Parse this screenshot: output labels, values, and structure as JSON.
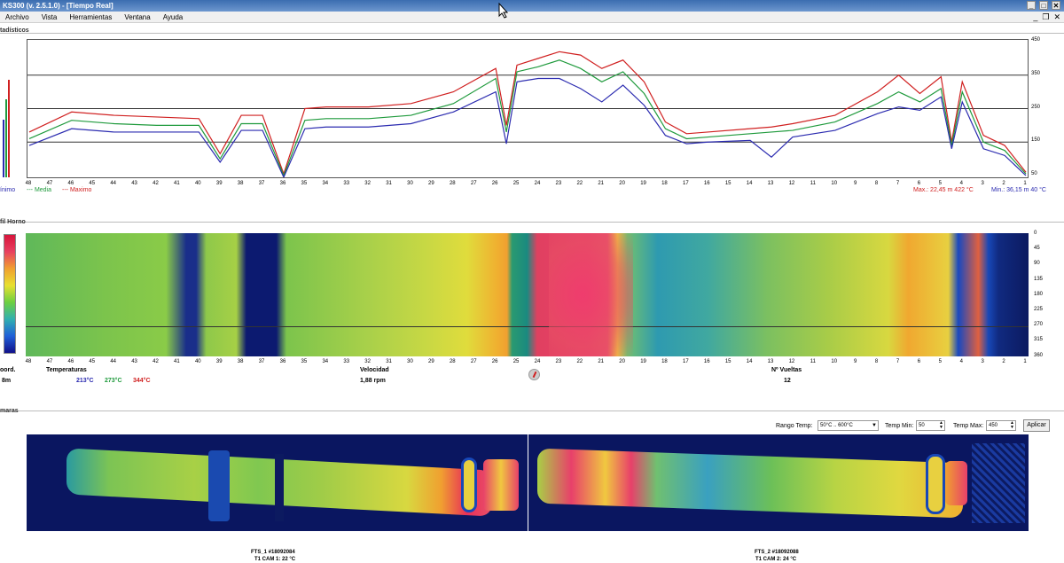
{
  "window": {
    "title": "KS300 (v. 2.5.1.0) - [Tiempo Real]",
    "controls": [
      "_",
      "□",
      "✕"
    ]
  },
  "menu": {
    "items": [
      "Archivo",
      "Vista",
      "Herramientas",
      "Ventana",
      "Ayuda"
    ],
    "mdi_controls": [
      "_",
      "❐",
      "✕"
    ]
  },
  "stats": {
    "title": "tadísticos",
    "y_ticks": [
      "450",
      "350",
      "250",
      "150",
      "50"
    ],
    "x_ticks": [
      "48",
      "47",
      "46",
      "45",
      "44",
      "43",
      "42",
      "41",
      "40",
      "39",
      "38",
      "37",
      "36",
      "35",
      "34",
      "33",
      "32",
      "31",
      "30",
      "29",
      "28",
      "27",
      "26",
      "25",
      "24",
      "23",
      "22",
      "21",
      "20",
      "19",
      "18",
      "17",
      "16",
      "15",
      "14",
      "13",
      "12",
      "11",
      "10",
      "9",
      "8",
      "7",
      "6",
      "5",
      "4",
      "3",
      "2",
      "1"
    ],
    "legend_min": "ínimo",
    "legend_media": "--- Media",
    "legend_max": "--- Maximo",
    "max_readout": "Max.: 22,45 m 422 °C",
    "min_readout": "Min.: 36,15 m 40 °C",
    "colors": {
      "min": "#2b2bb0",
      "media": "#1f9a3c",
      "max": "#d02020"
    }
  },
  "chart_data": {
    "type": "line",
    "x": [
      48,
      46,
      44,
      42,
      40,
      39,
      38,
      37,
      36,
      35,
      34,
      32,
      30,
      28,
      26,
      25.5,
      25,
      24,
      23,
      22,
      21,
      20,
      19,
      18,
      17,
      16,
      14,
      13,
      12,
      10,
      8,
      7,
      6,
      5,
      4.5,
      4,
      3,
      2,
      1
    ],
    "series": [
      {
        "name": "Maximo",
        "values": [
          180,
          240,
          230,
          225,
          220,
          115,
          230,
          230,
          55,
          250,
          255,
          255,
          265,
          300,
          370,
          200,
          380,
          400,
          420,
          410,
          370,
          395,
          330,
          210,
          175,
          180,
          190,
          195,
          205,
          230,
          300,
          350,
          295,
          345,
          150,
          330,
          170,
          140,
          60
        ]
      },
      {
        "name": "Media",
        "values": [
          160,
          215,
          205,
          200,
          200,
          100,
          205,
          205,
          50,
          215,
          220,
          220,
          230,
          265,
          340,
          180,
          360,
          375,
          395,
          370,
          330,
          360,
          295,
          190,
          160,
          165,
          175,
          180,
          185,
          210,
          265,
          300,
          270,
          310,
          140,
          300,
          150,
          125,
          55
        ]
      },
      {
        "name": "Minimo",
        "values": [
          140,
          190,
          180,
          180,
          180,
          90,
          185,
          185,
          45,
          190,
          195,
          195,
          205,
          240,
          300,
          145,
          330,
          340,
          340,
          310,
          270,
          320,
          260,
          170,
          145,
          150,
          155,
          105,
          165,
          185,
          235,
          255,
          245,
          285,
          130,
          270,
          130,
          110,
          50
        ]
      }
    ],
    "ylim": [
      50,
      450
    ]
  },
  "perfil": {
    "title": "fil Horno",
    "y_ticks": [
      "0",
      "45",
      "90",
      "135",
      "180",
      "225",
      "270",
      "315",
      "360"
    ],
    "coord_label": "oord.",
    "coord_value": "8m",
    "temp_label": "Temperaturas",
    "temp_min": "213°C",
    "temp_media": "273°C",
    "temp_max": "344°C",
    "vel_label": "Velocidad",
    "vel_value": "1,88 rpm",
    "vueltas_label": "Nº Vueltas",
    "vueltas_value": "12"
  },
  "camaras": {
    "title": "maras",
    "rango_label": "Rango Temp:",
    "rango_value": "50°C .. 600°C",
    "tmin_label": "Temp Min:",
    "tmin_value": "50",
    "tmax_label": "Temp Max:",
    "tmax_value": "450",
    "apply_label": "Aplicar",
    "cam1_label": "FTS_1 #18092084",
    "cam1_sub": "T1 CAM 1: 22 °C",
    "cam2_label": "FTS_2 #18092088",
    "cam2_sub": "T1 CAM 2: 24 °C"
  }
}
